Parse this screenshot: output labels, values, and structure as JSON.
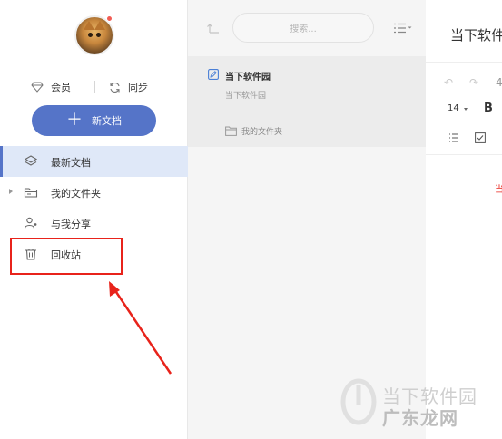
{
  "sidebar": {
    "vip_label": "会员",
    "sync_label": "同步",
    "new_doc_label": "新文档",
    "nav": [
      {
        "label": "最新文档",
        "icon": "layers-icon",
        "active": true
      },
      {
        "label": "我的文件夹",
        "icon": "folder-icon",
        "expandable": true
      },
      {
        "label": "与我分享",
        "icon": "share-user-icon"
      },
      {
        "label": "回收站",
        "icon": "trash-icon"
      }
    ]
  },
  "list": {
    "search_placeholder": "搜索...",
    "docs": [
      {
        "title": "当下软件园",
        "preview": "当下软件园",
        "folder": "我的文件夹"
      }
    ]
  },
  "editor": {
    "title": "当下软件",
    "font_size": "14",
    "bold_label": "B",
    "four_glyph": "4",
    "red_text": "当"
  },
  "watermark": {
    "line1": "当下软件园",
    "line2": "广东龙网"
  },
  "colors": {
    "accent": "#5574c8",
    "active_bg": "#dfe8f8",
    "annotation_red": "#e8231b"
  }
}
